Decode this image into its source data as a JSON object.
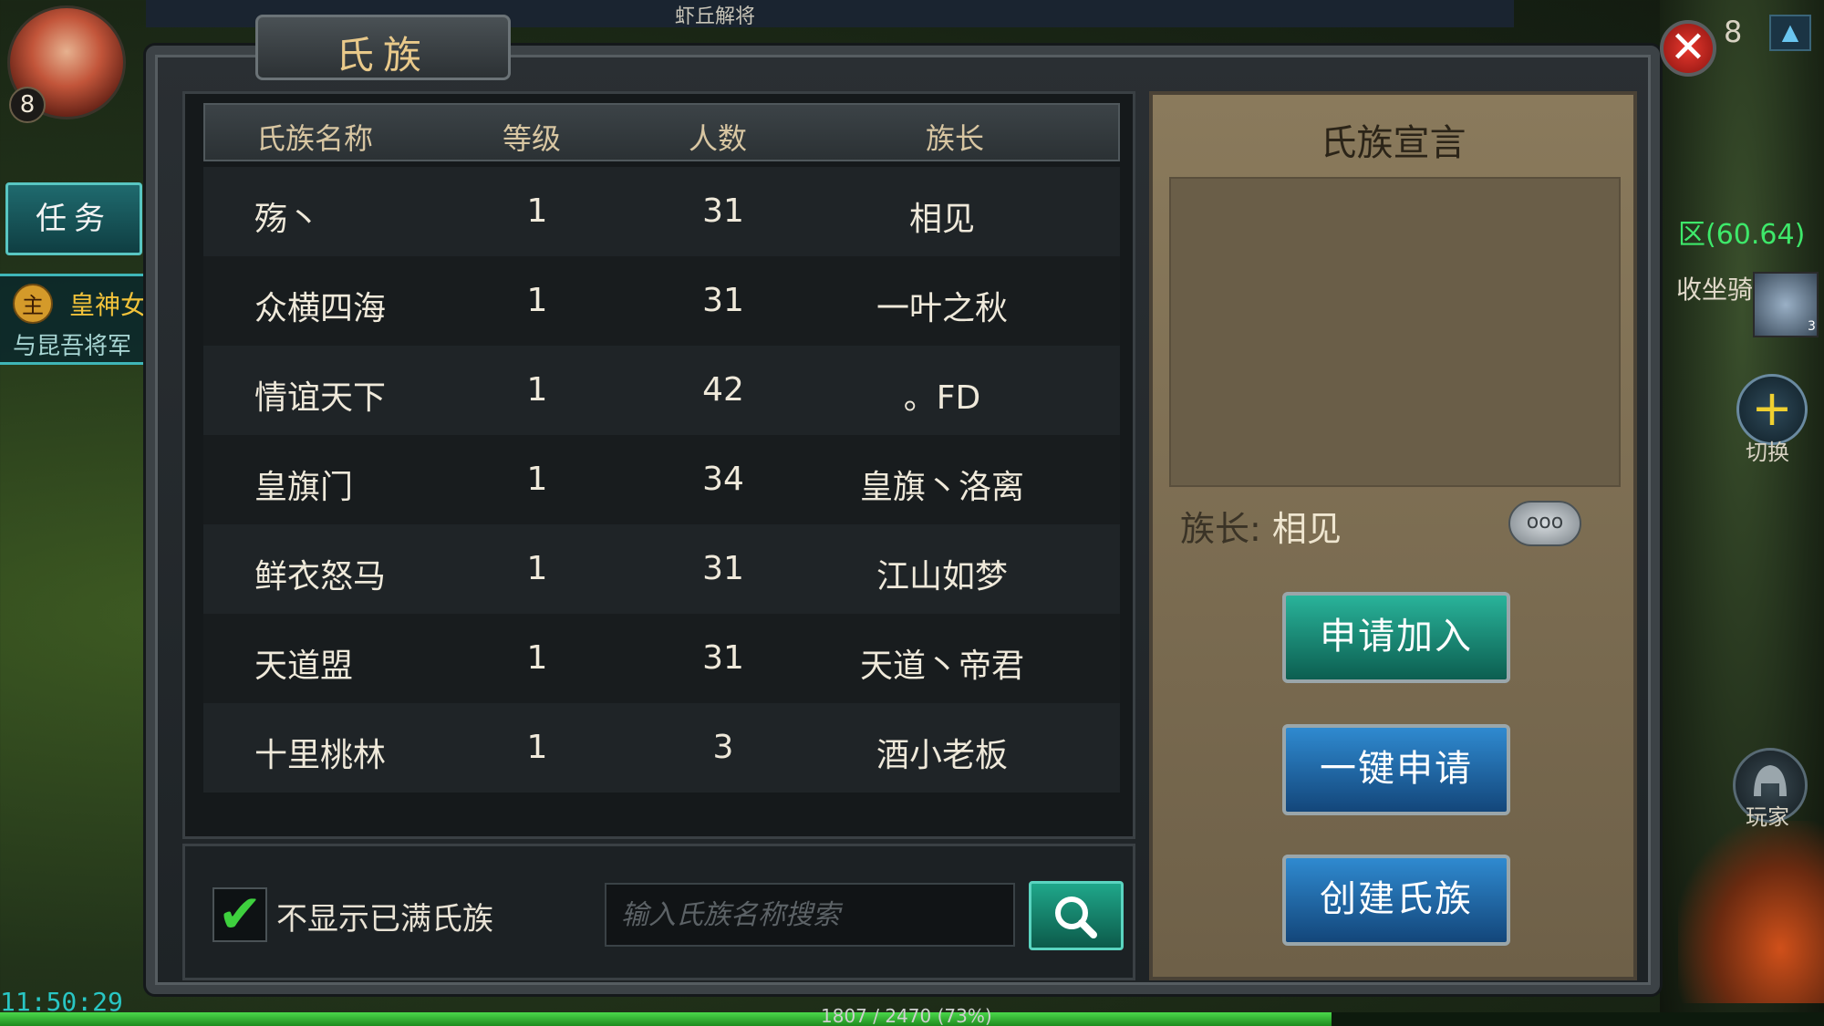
{
  "hud": {
    "player_level": "8",
    "task_button": "任务",
    "quest_badge": "主",
    "quest_name": "皇神女",
    "quest_desc": "与昆吾将军",
    "top_banner": "虾丘解将",
    "top_right_num": "8",
    "map_coords": "区(60.64)",
    "mount_label": "收坐骑",
    "mount_count": "3",
    "switch_label": "切换",
    "player_label": "玩家",
    "clock": "11:50:29",
    "exp_text": "1807 / 2470 (73%)",
    "exp_fraction": 0.73
  },
  "dialog": {
    "title": "氏族",
    "close_glyph": "✕"
  },
  "table": {
    "headers": [
      "氏族名称",
      "等级",
      "人数",
      "族长"
    ],
    "rows": [
      {
        "name": "殇丶",
        "level": "1",
        "members": "31",
        "leader": "相见"
      },
      {
        "name": "众横四海",
        "level": "1",
        "members": "31",
        "leader": "一叶之秋"
      },
      {
        "name": "情谊天下",
        "level": "1",
        "members": "42",
        "leader": "。FD"
      },
      {
        "name": "皇旗门",
        "level": "1",
        "members": "34",
        "leader": "皇旗丶洛离"
      },
      {
        "name": "鲜衣怒马",
        "level": "1",
        "members": "31",
        "leader": "江山如梦"
      },
      {
        "name": "天道盟",
        "level": "1",
        "members": "31",
        "leader": "天道丶帝君"
      },
      {
        "name": "十里桃林",
        "level": "1",
        "members": "3",
        "leader": "酒小老板"
      }
    ]
  },
  "filter": {
    "checked": true,
    "check_glyph": "✔",
    "label": "不显示已满氏族",
    "search_placeholder": "输入氏族名称搜索"
  },
  "manifesto": {
    "title": "氏族宣言",
    "leader_label": "族长:",
    "leader_name": "相见",
    "chat_glyph": "ooo"
  },
  "actions": {
    "join": "申请加入",
    "one_key": "一键申请",
    "create": "创建氏族"
  }
}
